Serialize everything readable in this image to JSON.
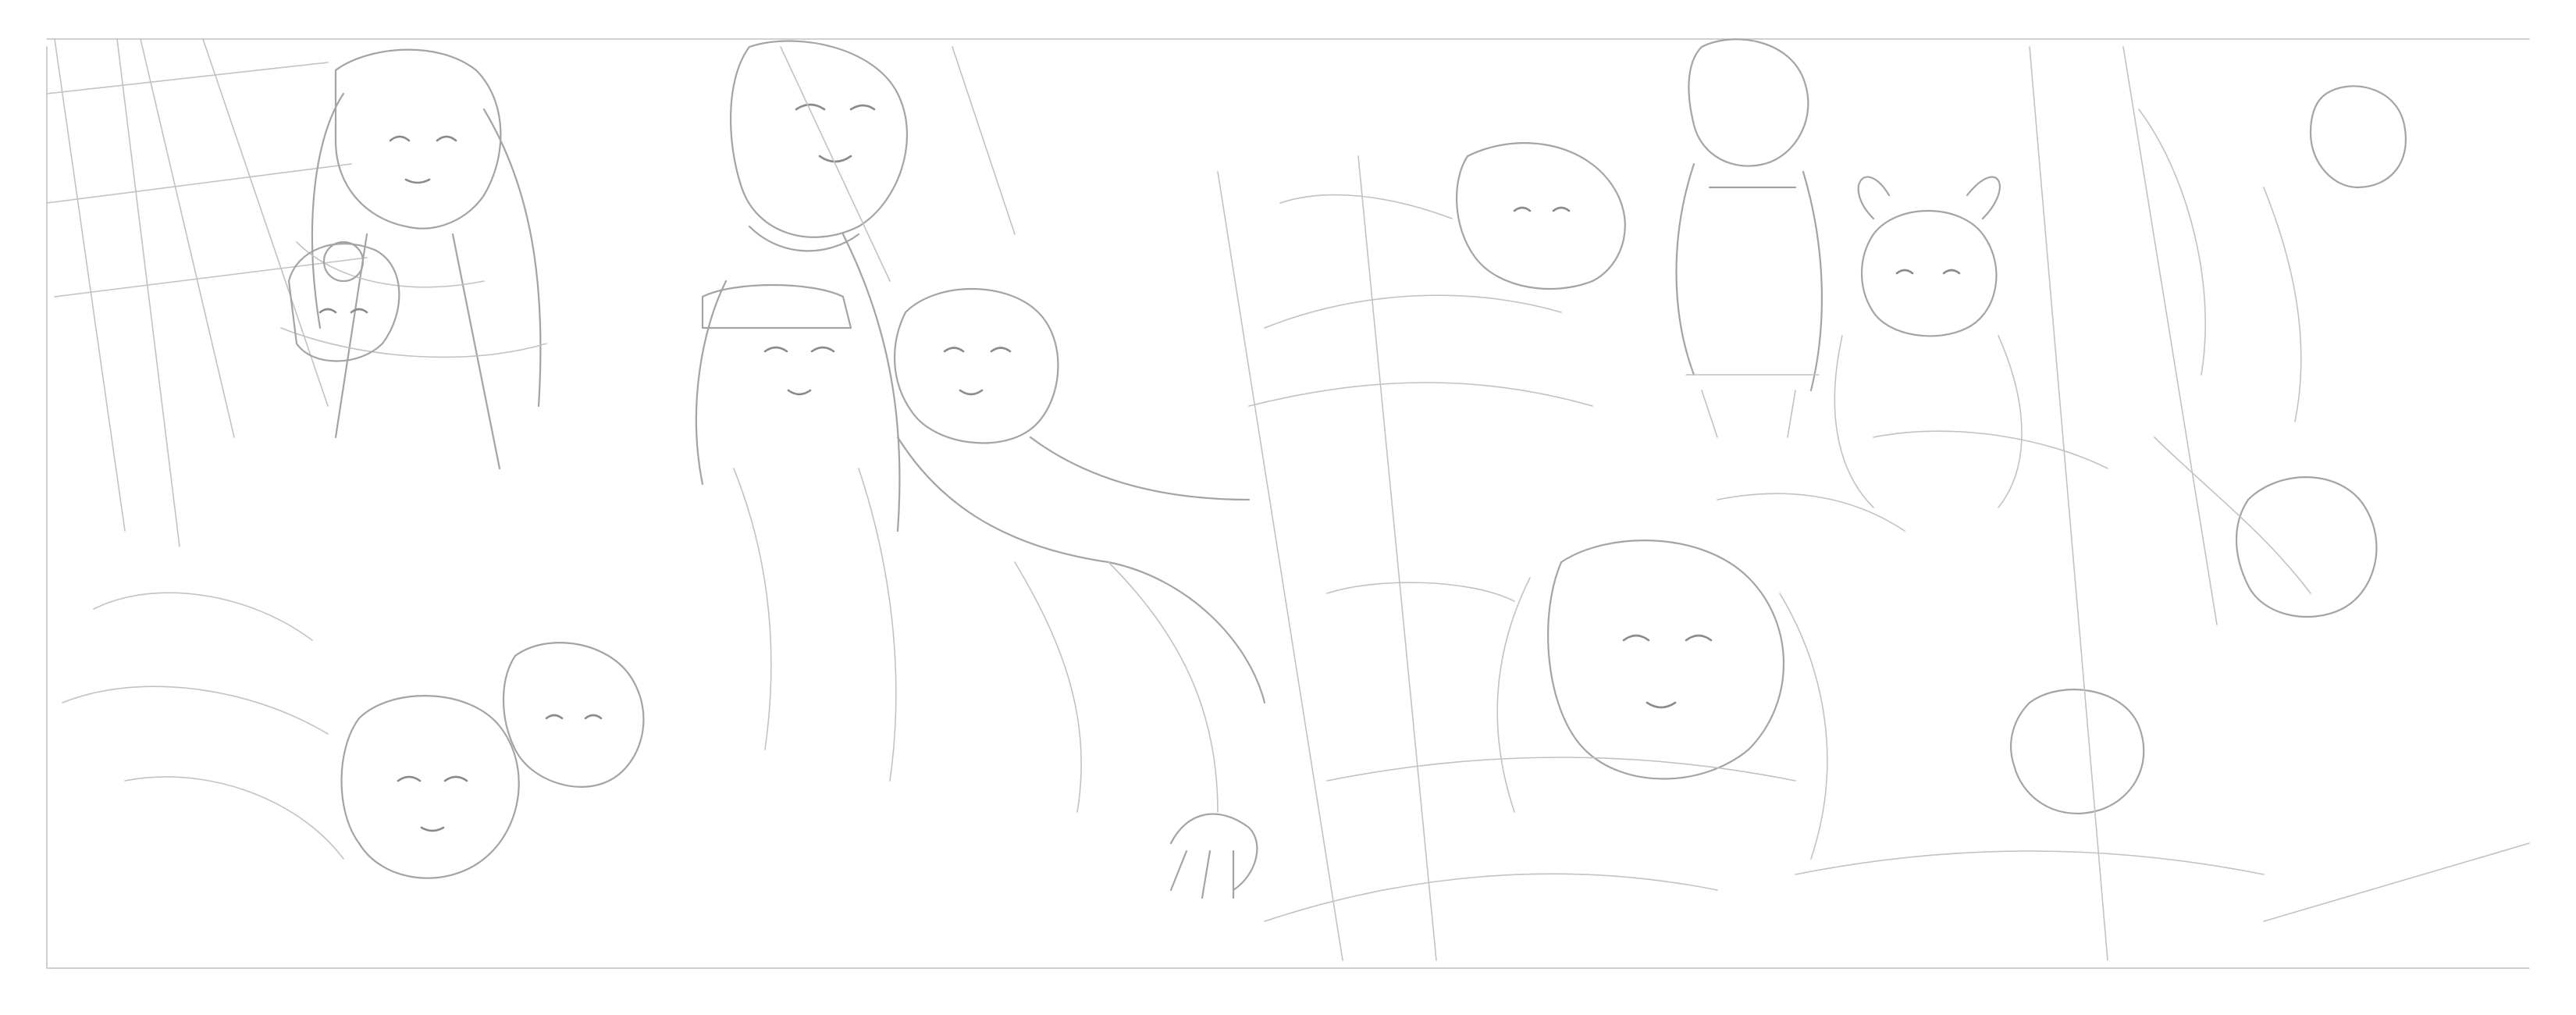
{
  "image": {
    "kind": "pencil-sketch",
    "palette": {
      "paper": "#ffffff",
      "line_dark": "#8a8a8a",
      "line_mid": "#a4a4a4",
      "line_light": "#c2c2c2"
    }
  }
}
